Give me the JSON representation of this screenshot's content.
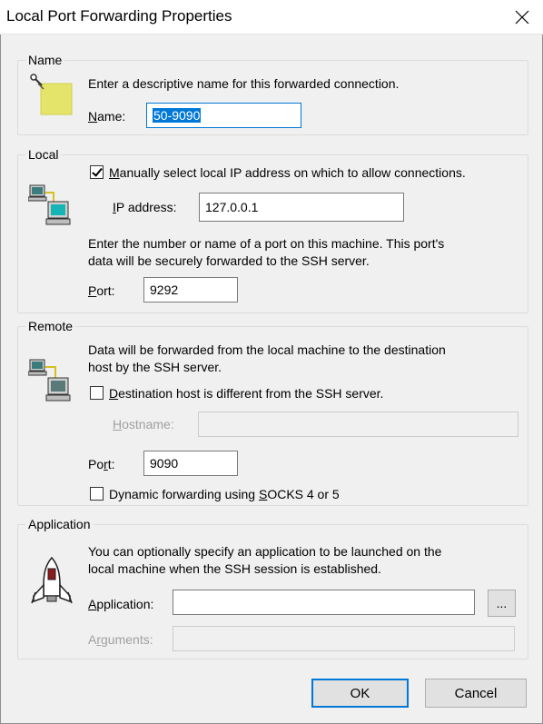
{
  "window": {
    "title": "Local Port Forwarding Properties"
  },
  "name_group": {
    "legend": "Name",
    "description": "Enter a descriptive name for this forwarded connection.",
    "name_label_first": "N",
    "name_label_rest": "ame:",
    "name_value": "50-9090"
  },
  "local_group": {
    "legend": "Local",
    "manual_checkbox_first": "M",
    "manual_checkbox_rest": "anually select local IP address on which to allow connections.",
    "manual_checked": true,
    "ip_label_first": "I",
    "ip_label_rest": "P address:",
    "ip_value": "127.0.0.1",
    "desc_line1": "Enter the number or name of a port on this machine.  This port's",
    "desc_line2": "data will be securely forwarded to the SSH server.",
    "port_label_first": "P",
    "port_label_rest": "ort:",
    "port_value": "9292"
  },
  "remote_group": {
    "legend": "Remote",
    "desc_line1": "Data will be forwarded from the local machine to the destination",
    "desc_line2": "host by the SSH server.",
    "dest_checkbox_first": "D",
    "dest_checkbox_rest": "estination host is different from the SSH server.",
    "hostname_label_first": "H",
    "hostname_label_rest": "ostname:",
    "hostname_value": "",
    "port_label_a": "Po",
    "port_label_u": "r",
    "port_label_b": "t:",
    "port_value": "9090",
    "socks_checkbox_a": "Dynamic forwarding using ",
    "socks_checkbox_u": "S",
    "socks_checkbox_b": "OCKS 4 or 5"
  },
  "application_group": {
    "legend": "Application",
    "desc_line1": "You can optionally specify an application to be launched on the",
    "desc_line2": "local machine when the SSH session is established.",
    "app_label_first": "A",
    "app_label_rest": "pplication:",
    "app_value": "",
    "browse_label": "...",
    "args_label_a": "A",
    "args_label_u": "r",
    "args_label_b": "guments:",
    "args_value": ""
  },
  "buttons": {
    "ok": "OK",
    "cancel": "Cancel"
  },
  "colors": {
    "accent": "#0078d7",
    "selection": "#0078d7",
    "name_icon_fill": "#e4e46a"
  },
  "icons": [
    "close-icon",
    "pin-note-icon",
    "computer-icon",
    "remote-computer-icon",
    "rocket-icon"
  ]
}
